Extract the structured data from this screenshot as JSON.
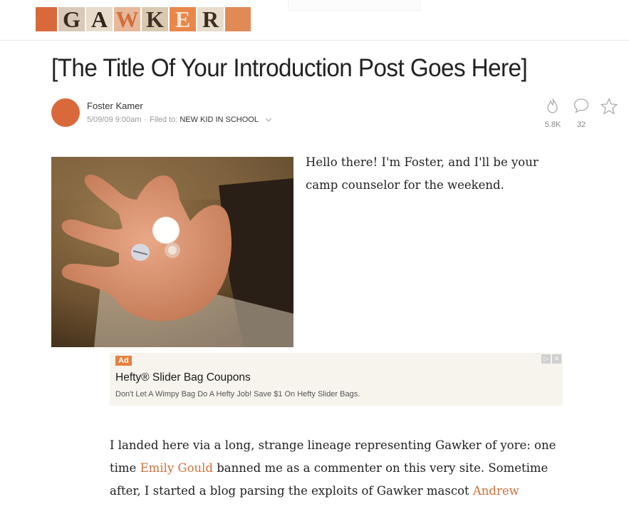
{
  "site": {
    "logo_letters": [
      "",
      "G",
      "A",
      "W",
      "K",
      "E",
      "R",
      ""
    ]
  },
  "post": {
    "title": "[The Title Of Your Introduction Post Goes Here]",
    "author": "Foster Kamer",
    "date": "5/09/09 9:00am",
    "filed_to_label": "Filed to:",
    "filed_to_tag": "NEW KID IN SCHOOL",
    "views": "5.8K",
    "comments": "32"
  },
  "intro": {
    "text": "Hello there! I'm Foster, and I'll be your camp counselor for the weekend."
  },
  "ad": {
    "badge": "Ad",
    "title": "Hefty® Slider Bag Coupons",
    "text": "Don't Let A Wimpy Bag Do A Hefty Job! Save $1 On Hefty Slider Bags."
  },
  "body": {
    "l1": "I landed here via a long, strange lineage representing Gawker of yore: one",
    "l2a": "time ",
    "l2_link": "Emily Gould",
    "l2b": " banned me as a commenter on this very site. Sometime",
    "l3a": "after, I started a blog parsing the exploits of Gawker mascot ",
    "l3_link": "Andrew"
  },
  "colors": {
    "accent": "#d9693b",
    "link": "#d2703c"
  },
  "icons": [
    "flame-icon",
    "comment-icon",
    "star-icon",
    "chevron-down-icon"
  ]
}
